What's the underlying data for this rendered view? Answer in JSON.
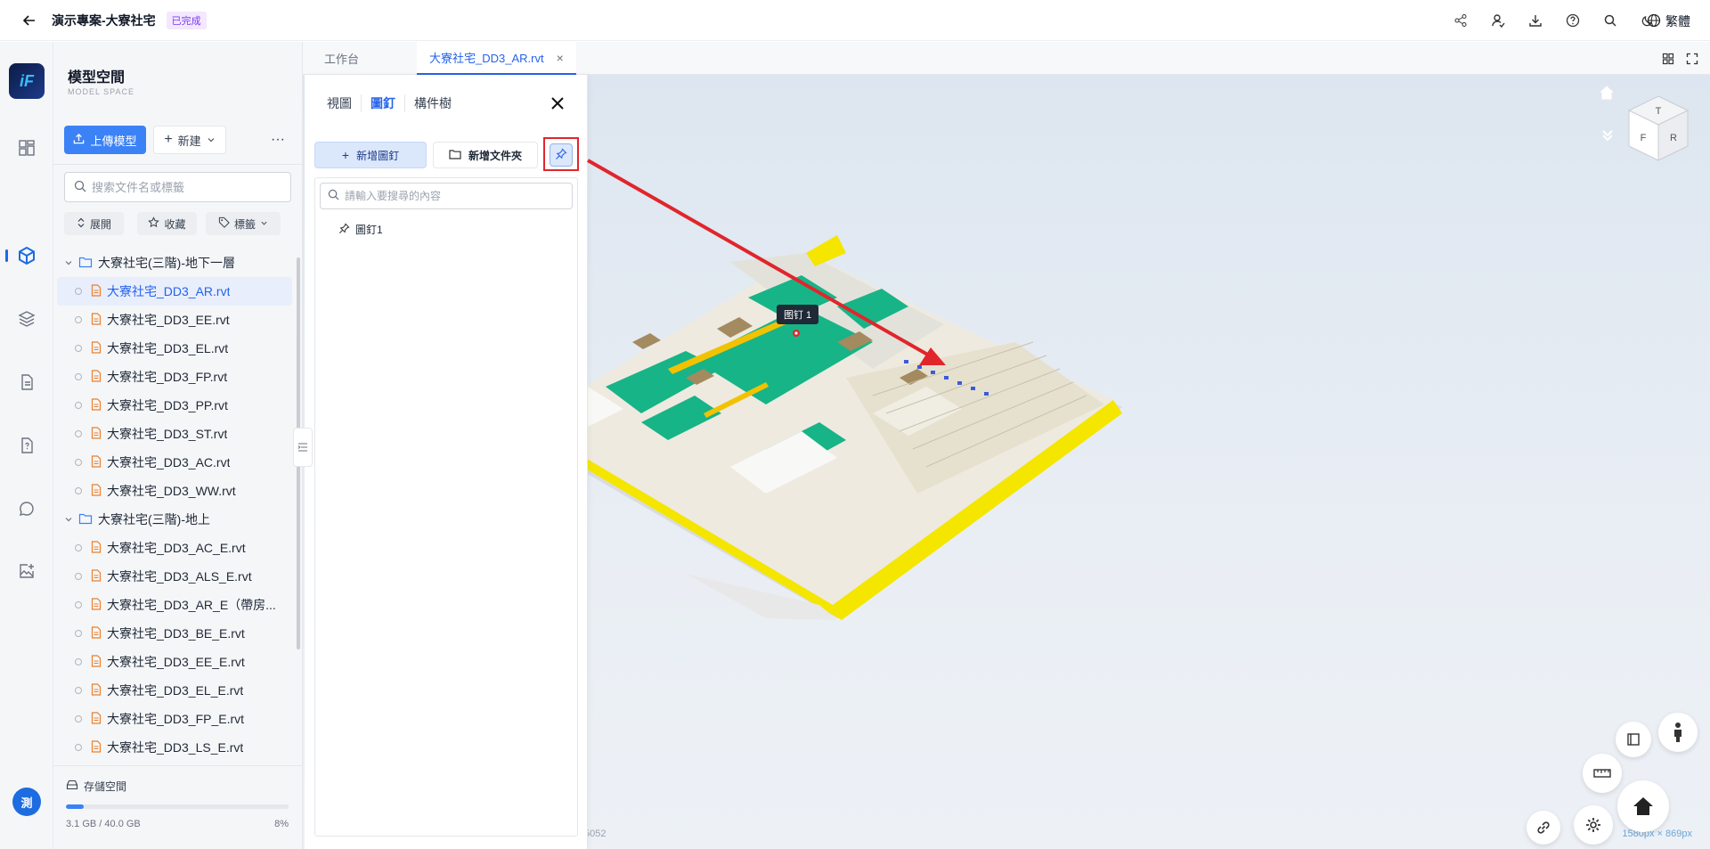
{
  "header": {
    "project_title": "演示專案-大寮社宅",
    "status_badge": "已完成",
    "language": "繁體",
    "action_icons": [
      "share-icon",
      "user-switch-icon",
      "download-icon",
      "help-icon",
      "search-icon",
      "dark-mode-icon",
      "globe-icon"
    ]
  },
  "rail": {
    "logo_text": "iF",
    "icons": [
      "dashboard-icon",
      "cube-icon",
      "layers-icon",
      "document-icon",
      "report-icon",
      "chat-icon",
      "image-add-icon"
    ],
    "avatar_text": "測"
  },
  "file_panel": {
    "title": "模型空間",
    "subtitle": "MODEL SPACE",
    "upload_label": "上傳模型",
    "new_label": "新建",
    "more_label": "···",
    "search_placeholder": "搜索文件名或標籤",
    "filters": [
      "展開",
      "收藏",
      "標籤"
    ],
    "tree": [
      {
        "folder": "大寮社宅(三階)-地下一層",
        "files": [
          "大寮社宅_DD3_AR.rvt",
          "大寮社宅_DD3_EE.rvt",
          "大寮社宅_DD3_EL.rvt",
          "大寮社宅_DD3_FP.rvt",
          "大寮社宅_DD3_PP.rvt",
          "大寮社宅_DD3_ST.rvt",
          "大寮社宅_DD3_AC.rvt",
          "大寮社宅_DD3_WW.rvt"
        ]
      },
      {
        "folder": "大寮社宅(三階)-地上",
        "files": [
          "大寮社宅_DD3_AC_E.rvt",
          "大寮社宅_DD3_ALS_E.rvt",
          "大寮社宅_DD3_AR_E（帶房...",
          "大寮社宅_DD3_BE_E.rvt",
          "大寮社宅_DD3_EE_E.rvt",
          "大寮社宅_DD3_EL_E.rvt",
          "大寮社宅_DD3_FP_E.rvt",
          "大寮社宅_DD3_LS_E.rvt"
        ]
      }
    ],
    "selected_file": "大寮社宅_DD3_AR.rvt",
    "storage": {
      "label": "存儲空間",
      "used_text": "3.1 GB / 40.0 GB",
      "percent_text": "8%",
      "fraction": 0.08
    }
  },
  "doc_tabs": {
    "tabs": [
      "工作台",
      "大寮社宅_DD3_AR.rvt"
    ],
    "active_index": 1,
    "close_symbol": "×"
  },
  "pin_panel": {
    "tabs": [
      "視圖",
      "圖釘",
      "構件樹"
    ],
    "active_tab": "圖釘",
    "add_pin_label": "新增圖釘",
    "add_folder_label": "新增文件夾",
    "search_placeholder": "請輸入要搜尋的內容",
    "items": [
      "圖釘1"
    ]
  },
  "viewport": {
    "pin_tooltip": "图钉 1",
    "coord_text": "5052",
    "resolution_text": "1580px × 869px",
    "nav_cube_faces": [
      "T",
      "F",
      "R"
    ]
  },
  "colors": {
    "accent": "#2563eb",
    "highlight_red": "#e0262b",
    "model_yellow": "#ffef00",
    "model_green": "#10b981"
  }
}
